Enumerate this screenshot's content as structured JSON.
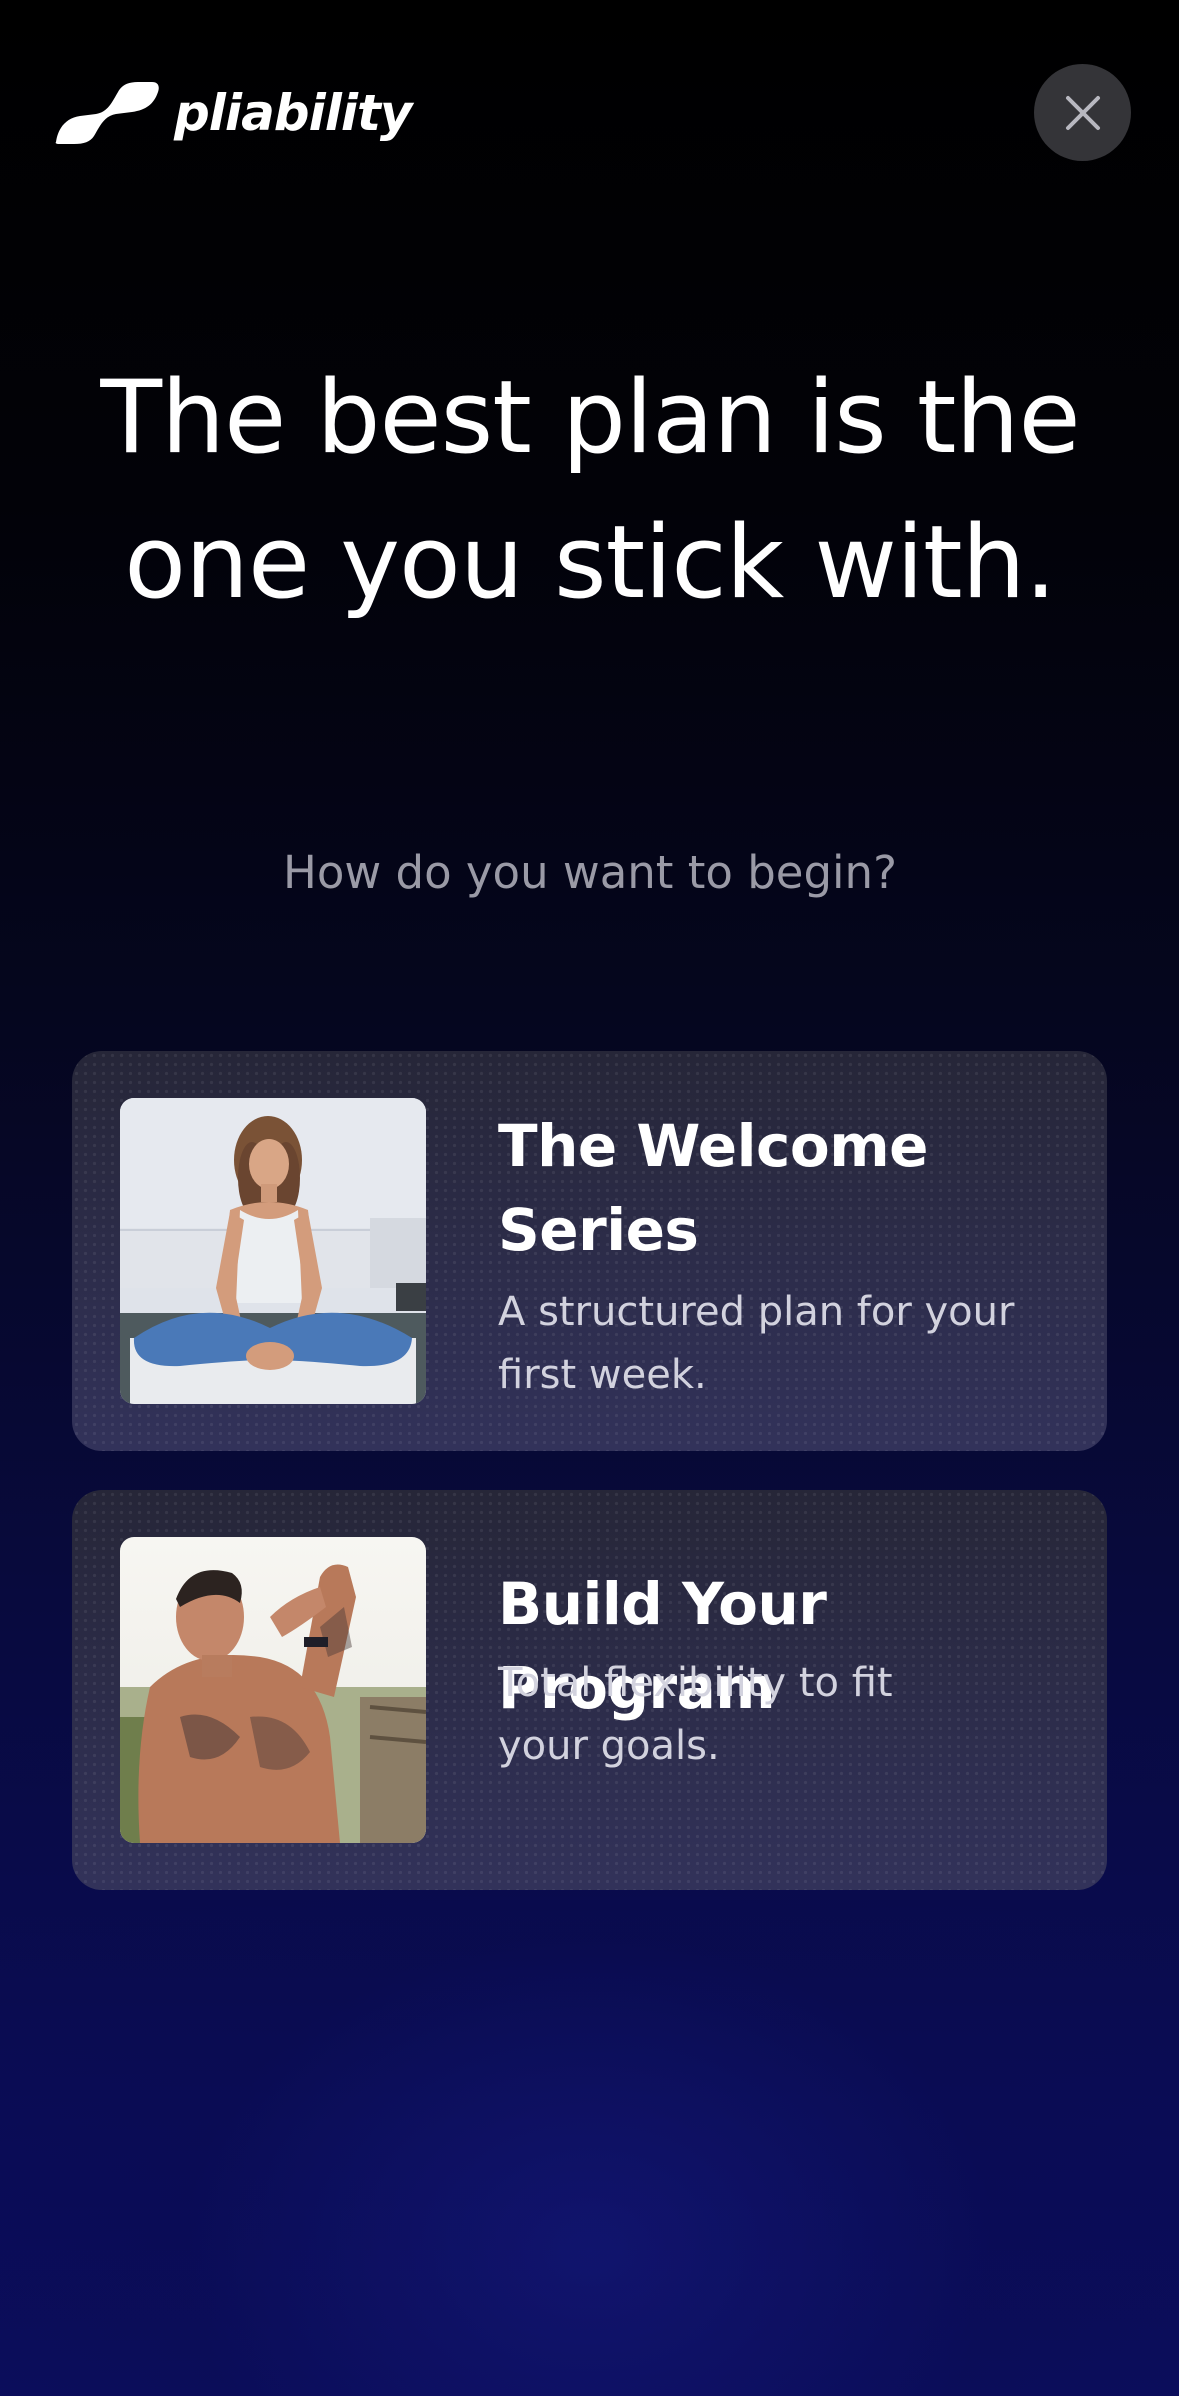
{
  "header": {
    "brand_name": "pliability"
  },
  "headline": "The best plan is the one you stick with.",
  "subhead": "How do you want to begin?",
  "options": [
    {
      "title": "The Welcome Series",
      "description": "A structured plan for your first week."
    },
    {
      "title": "Build Your Program",
      "description": "Total flexibility to fit your goals."
    }
  ],
  "colors": {
    "background_top": "#000000",
    "background_bottom": "#0b0d5c",
    "card": "#2b2b48",
    "close_button": "#343438",
    "subhead_text": "#9a9aa6"
  },
  "icons": {
    "logo": "pliability-logo-mark",
    "close": "close-icon"
  }
}
